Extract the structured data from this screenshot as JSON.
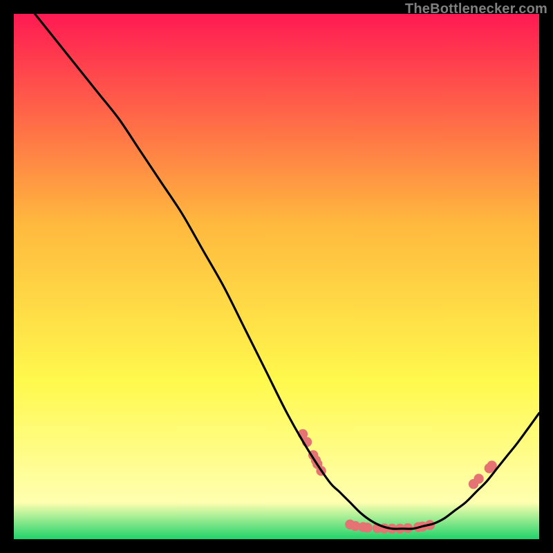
{
  "watermark": "TheBottlenecker.com",
  "chart_data": {
    "type": "line",
    "title": "",
    "xlabel": "",
    "ylabel": "",
    "xlim": [
      0,
      100
    ],
    "ylim": [
      0,
      100
    ],
    "grid": false,
    "legend": false,
    "series": [
      {
        "name": "bottleneck-curve",
        "x": [
          4,
          8,
          12,
          16,
          20,
          24,
          28,
          32,
          36,
          40,
          44,
          48,
          52,
          56,
          60,
          62,
          64,
          66,
          68,
          70,
          72,
          74,
          76,
          78,
          80,
          82,
          84,
          86,
          88,
          90,
          92,
          94,
          96,
          100
        ],
        "values": [
          100,
          95,
          90,
          85,
          80,
          74,
          68,
          62,
          55,
          48,
          40,
          32,
          24,
          17,
          11,
          9,
          7,
          5,
          3.5,
          2.5,
          2,
          2,
          2,
          2.5,
          3,
          4,
          5.5,
          7,
          9,
          11,
          13.5,
          16,
          18.5,
          24
        ]
      }
    ],
    "markers": [
      {
        "x": 55,
        "y": 20
      },
      {
        "x": 55.8,
        "y": 18.5
      },
      {
        "x": 57,
        "y": 16
      },
      {
        "x": 57.5,
        "y": 15
      },
      {
        "x": 57.8,
        "y": 14.3
      },
      {
        "x": 58.5,
        "y": 13
      },
      {
        "x": 64,
        "y": 2.8
      },
      {
        "x": 65,
        "y": 2.5
      },
      {
        "x": 66.5,
        "y": 2.3
      },
      {
        "x": 67.3,
        "y": 2.2
      },
      {
        "x": 69.2,
        "y": 2.1
      },
      {
        "x": 70.5,
        "y": 2.05
      },
      {
        "x": 72,
        "y": 2.0
      },
      {
        "x": 73.5,
        "y": 2.0
      },
      {
        "x": 75,
        "y": 2.1
      },
      {
        "x": 77,
        "y": 2.3
      },
      {
        "x": 77.8,
        "y": 2.4
      },
      {
        "x": 79.2,
        "y": 2.7
      },
      {
        "x": 87.5,
        "y": 10.5
      },
      {
        "x": 88.5,
        "y": 11.5
      },
      {
        "x": 90.5,
        "y": 13.5
      },
      {
        "x": 91,
        "y": 14
      }
    ],
    "colors": {
      "marker_fill": "#e57373",
      "marker_stroke": "#d35050",
      "curve": "#000000",
      "gradient_top": "#ff1a52",
      "gradient_mid1": "#ffb93e",
      "gradient_mid2": "#fff94d",
      "gradient_band": "#ffffb0",
      "gradient_bottom": "#1fd36a"
    }
  }
}
